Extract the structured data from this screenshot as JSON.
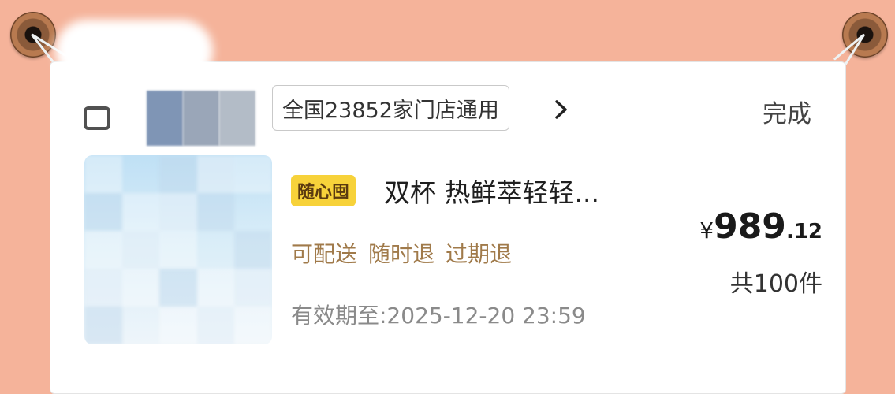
{
  "card": {
    "store_scope": "全国23852家门店通用",
    "done_label": "完成"
  },
  "icons": {
    "chevron": "chevron-right-icon",
    "logo": "store-logo"
  },
  "product": {
    "badge": "随心囤",
    "title": "双杯 热鲜萃轻轻...",
    "features": [
      "可配送",
      "随时退",
      "过期退"
    ],
    "expiry": "有效期至:2025-12-20 23:59",
    "price_currency": "¥",
    "price_integer": "989",
    "price_decimal": ".12",
    "count": "共100件"
  },
  "colors": {
    "background": "#f5b39a",
    "badge": "#f7d23a",
    "feature_text": "#a07a4a"
  }
}
